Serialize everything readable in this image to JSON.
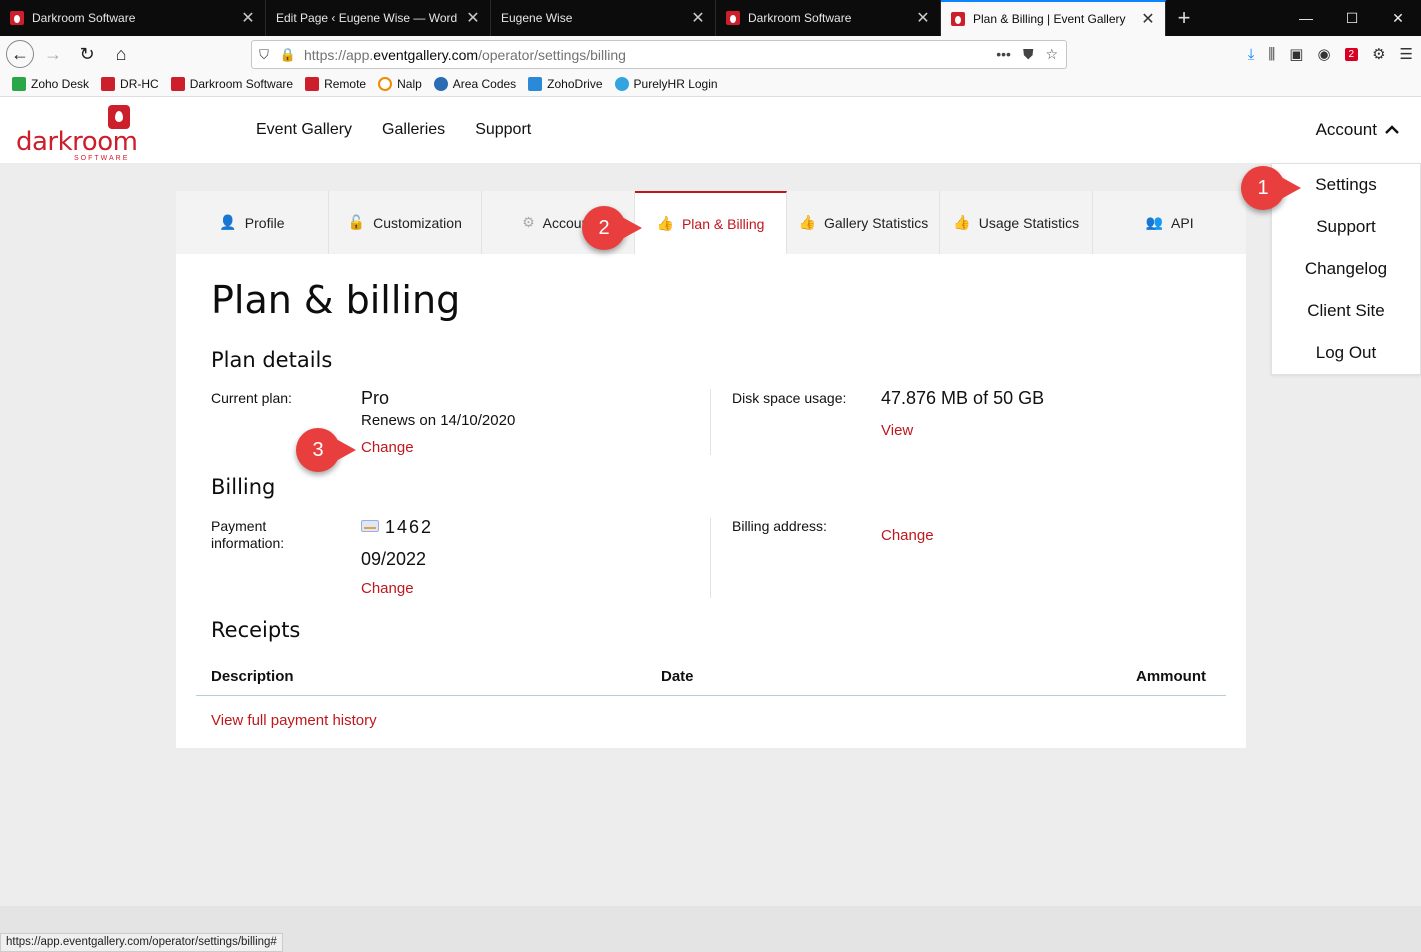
{
  "browser": {
    "tabs": [
      {
        "title": "Darkroom Software",
        "active": false
      },
      {
        "title": "Edit Page ‹ Eugene Wise — WordPr",
        "active": false
      },
      {
        "title": "Eugene Wise",
        "active": false
      },
      {
        "title": "Darkroom Software",
        "active": false
      },
      {
        "title": "Plan & Billing | Event Gallery",
        "active": true
      }
    ],
    "url_prefix": "https://app.",
    "url_domain": "eventgallery.com",
    "url_path": "/operator/settings/billing",
    "toolbar_badge": "2",
    "bookmarks": [
      {
        "label": "Zoho Desk",
        "color": "#2aa847"
      },
      {
        "label": "DR-HC",
        "color": "#cc1f2b"
      },
      {
        "label": "Darkroom Software",
        "color": "#cc1f2b"
      },
      {
        "label": "Remote",
        "color": "#cc1f2b"
      },
      {
        "label": "Nalp",
        "color": "#f08a00"
      },
      {
        "label": "Area Codes",
        "color": "#2b6cb5"
      },
      {
        "label": "ZohoDrive",
        "color": "#2b8ad8"
      },
      {
        "label": "PurelyHR Login",
        "color": "#34a4e0"
      }
    ],
    "status_url": "https://app.eventgallery.com/operator/settings/billing#"
  },
  "site": {
    "logo_word": "darkroom",
    "logo_sub": "SOFTWARE",
    "nav": [
      "Event Gallery",
      "Galleries",
      "Support"
    ],
    "account_label": "Account",
    "dropdown": [
      "Settings",
      "Support",
      "Changelog",
      "Client Site",
      "Log Out"
    ]
  },
  "settings_tabs": [
    {
      "label": "Profile",
      "icon": "user-icon",
      "glyph": "👤"
    },
    {
      "label": "Customization",
      "icon": "lock-icon",
      "glyph": "🔓"
    },
    {
      "label": "Account",
      "icon": "gear-icon",
      "glyph": "⚙"
    },
    {
      "label": "Plan & Billing",
      "icon": "thumbs-up-icon",
      "glyph": "👍"
    },
    {
      "label": "Gallery Statistics",
      "icon": "thumbs-up-icon",
      "glyph": "👍"
    },
    {
      "label": "Usage Statistics",
      "icon": "thumbs-up-icon",
      "glyph": "👍"
    },
    {
      "label": "API",
      "icon": "group-icon",
      "glyph": "👥"
    }
  ],
  "page": {
    "title": "Plan & billing",
    "plan_heading": "Plan details",
    "current_plan_label": "Current plan:",
    "plan_name": "Pro",
    "renews": "Renews on 14/10/2020",
    "plan_change": "Change",
    "disk_label": "Disk space usage:",
    "disk_value": "47.876 MB of 50 GB",
    "disk_view": "View",
    "billing_heading": "Billing",
    "payment_label": "Payment information:",
    "card_last4": "1462",
    "card_expiry": "09/2022",
    "payment_change": "Change",
    "billing_address_label": "Billing address:",
    "billing_address_change": "Change",
    "receipts_heading": "Receipts",
    "receipts_columns": [
      "Description",
      "Date",
      "Ammount"
    ],
    "history_link": "View full payment history"
  },
  "callouts": [
    "1",
    "2",
    "3"
  ]
}
